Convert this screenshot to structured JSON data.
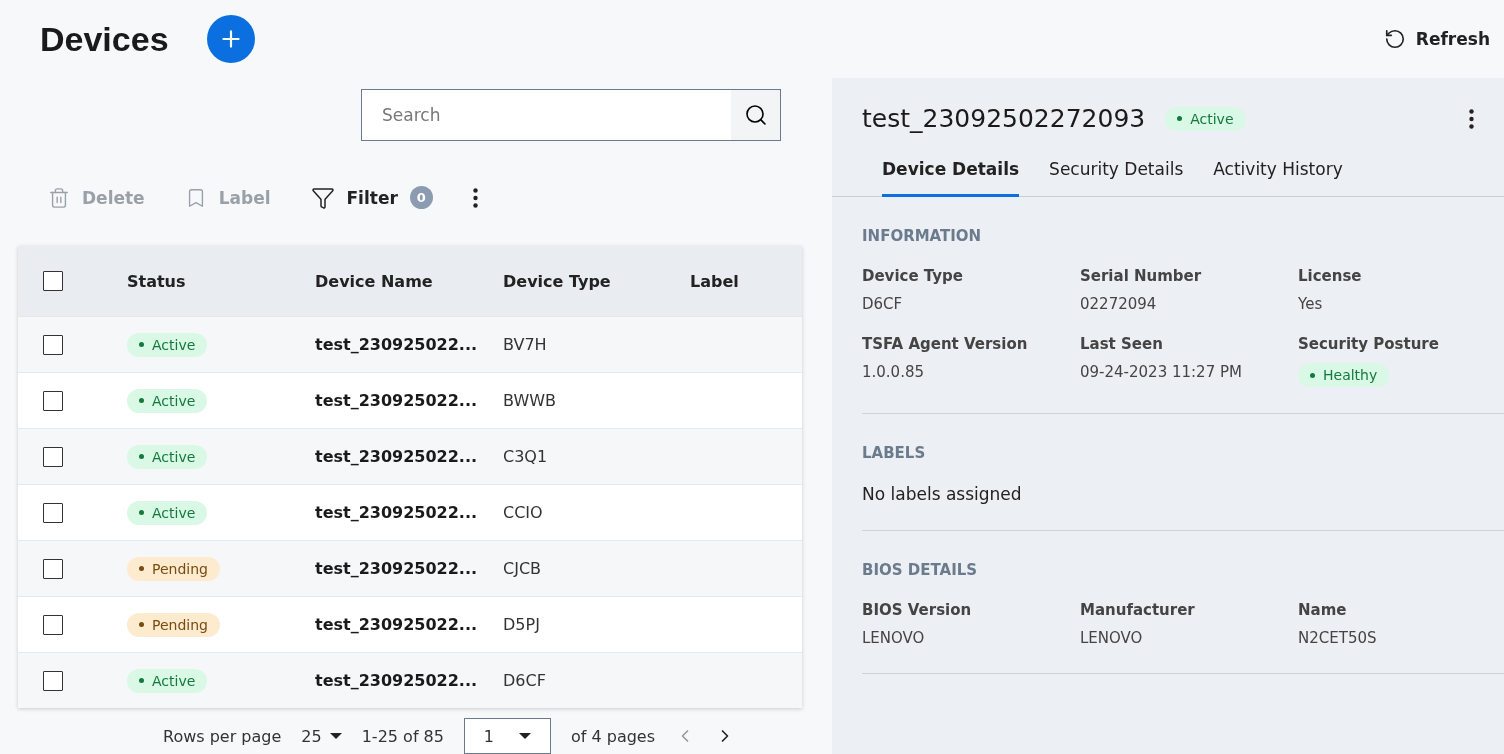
{
  "header": {
    "title": "Devices",
    "refresh": "Refresh"
  },
  "search": {
    "placeholder": "Search"
  },
  "toolbar": [
    {
      "kind": "delete",
      "label": "Delete",
      "disabled": true
    },
    {
      "kind": "label",
      "label": "Label",
      "disabled": true
    },
    {
      "kind": "filter",
      "label": "Filter",
      "count": "0",
      "disabled": false
    }
  ],
  "table": {
    "select_all": {
      "checked": false
    },
    "columns": [
      "Status",
      "Device Name",
      "Device Type",
      "Label"
    ],
    "rows": [
      {
        "status": "Active",
        "kind": "active",
        "name": "test_230925022...",
        "type": "BV7H",
        "checked": false
      },
      {
        "status": "Active",
        "kind": "active",
        "name": "test_230925022...",
        "type": "BWWB",
        "checked": false
      },
      {
        "status": "Active",
        "kind": "active",
        "name": "test_230925022...",
        "type": "C3Q1",
        "checked": false
      },
      {
        "status": "Active",
        "kind": "active",
        "name": "test_230925022...",
        "type": "CCIO",
        "checked": false
      },
      {
        "status": "Pending",
        "kind": "pending",
        "name": "test_230925022...",
        "type": "CJCB",
        "checked": false
      },
      {
        "status": "Pending",
        "kind": "pending",
        "name": "test_230925022...",
        "type": "D5PJ",
        "checked": false
      },
      {
        "status": "Active",
        "kind": "active",
        "name": "test_230925022...",
        "type": "D6CF",
        "checked": false
      }
    ]
  },
  "pagination": {
    "rows_per_page_label": "Rows per page",
    "rows_per_page": "25",
    "range": "1-25 of 85",
    "page": "1",
    "pages": "of 4 pages"
  },
  "detail": {
    "title": "test_23092502272093",
    "status": {
      "label": "Active",
      "kind": "active"
    },
    "tabs": [
      {
        "label": "Device Details",
        "selected": true
      },
      {
        "label": "Security Details",
        "selected": false
      },
      {
        "label": "Activity History",
        "selected": false
      }
    ],
    "sections": [
      {
        "kind": "fields",
        "heading": "INFORMATION",
        "fields": [
          {
            "label": "Device Type",
            "value": "D6CF",
            "kind": "text"
          },
          {
            "label": "Serial Number",
            "value": "02272094",
            "kind": "text"
          },
          {
            "label": "License",
            "value": "Yes",
            "kind": "text"
          },
          {
            "label": "TSFA Agent Version",
            "value": "1.0.0.85",
            "kind": "text"
          },
          {
            "label": "Last Seen",
            "value": "09-24-2023 11:27 PM",
            "kind": "text"
          },
          {
            "label": "Security Posture",
            "value": "Healthy",
            "kind": "badge"
          }
        ]
      },
      {
        "kind": "note",
        "heading": "LABELS",
        "text": "No labels assigned"
      },
      {
        "kind": "fields",
        "heading": "BIOS DETAILS",
        "fields": [
          {
            "label": "BIOS Version",
            "value": "LENOVO",
            "kind": "text"
          },
          {
            "label": "Manufacturer",
            "value": "LENOVO",
            "kind": "text"
          },
          {
            "label": "Name",
            "value": "N2CET50S",
            "kind": "text"
          }
        ]
      }
    ]
  }
}
